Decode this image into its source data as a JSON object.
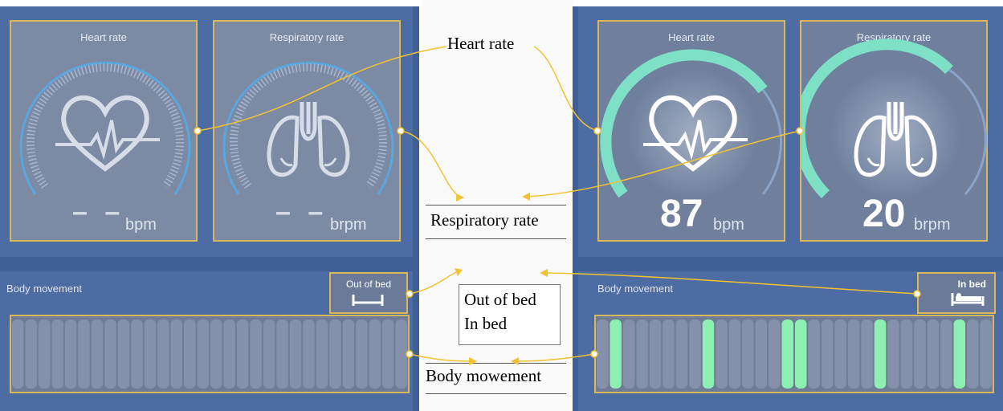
{
  "left_panel": {
    "heart": {
      "title": "Heart rate",
      "value": "– –",
      "unit": "bpm"
    },
    "resp": {
      "title": "Respiratory rate",
      "value": "– –",
      "unit": "brpm"
    },
    "movement": {
      "label": "Body movement",
      "bed_status": "Out of bed"
    }
  },
  "right_panel": {
    "heart": {
      "title": "Heart rate",
      "value": "87",
      "unit": "bpm"
    },
    "resp": {
      "title": "Respiratory rate",
      "value": "20",
      "unit": "brpm"
    },
    "movement": {
      "label": "Body movement",
      "bed_status": "In bed"
    }
  },
  "annotations": {
    "heart_rate": "Heart rate",
    "respiratory_rate": "Respiratory rate",
    "out_of_bed": "Out of bed",
    "in_bed": "In bed",
    "body_movement": "Body mowement"
  },
  "colors": {
    "panel": "#3f5f96",
    "card_border": "#d9b85a",
    "gauge_active": "#7fe0c8",
    "movement_bar": "#8ef0b0",
    "connector": "#f2c230"
  },
  "icons": [
    "heart-icon",
    "lungs-icon",
    "bed-icon"
  ]
}
